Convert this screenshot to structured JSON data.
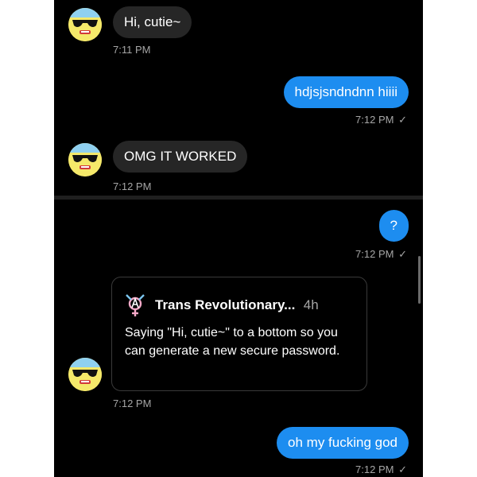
{
  "messages": {
    "m1": {
      "text": "Hi, cutie~",
      "time": "7:11 PM"
    },
    "m2": {
      "text": "hdjsjsndndnn hiiii",
      "time": "7:12 PM",
      "check": "✓"
    },
    "m3": {
      "text": "OMG IT WORKED",
      "time": "7:12 PM"
    },
    "m4": {
      "text": "?",
      "time": "7:12 PM",
      "check": "✓"
    },
    "m5": {
      "card_author": "Trans Revolutionary...",
      "card_age": "4h",
      "card_text": "Saying \"Hi, cutie~\" to a bottom so you can generate a new secure password.",
      "time": "7:12 PM"
    },
    "m6": {
      "text": "oh my fucking god",
      "time": "7:12 PM",
      "check": "✓"
    }
  },
  "colors": {
    "background": "#000000",
    "incoming_bubble": "#262626",
    "outgoing_bubble": "#1d8df0",
    "timestamp": "#a6a6a6"
  },
  "icons": {
    "avatar": "sunglasses-face-avatar",
    "card_symbol": "transgender-anarchy-symbol-icon",
    "read_receipt": "checkmark-icon"
  }
}
